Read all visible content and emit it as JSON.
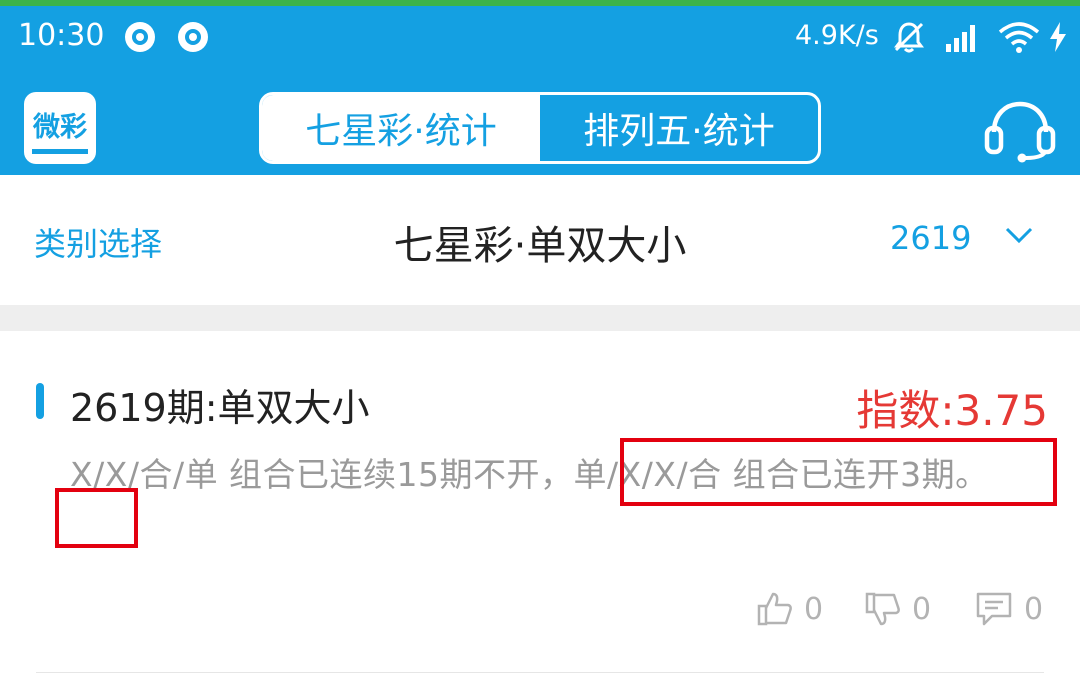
{
  "status_bar": {
    "time": "10:30",
    "net_speed": "4.9K/s",
    "icons": [
      "notification-dot-icon",
      "notification-dot-icon",
      "mute-icon",
      "signal-icon",
      "wifi-icon",
      "charging-icon"
    ]
  },
  "nav": {
    "logo_text": "微彩",
    "tabs": [
      {
        "label": "七星彩·统计",
        "active": true
      },
      {
        "label": "排列五·统计",
        "active": false
      }
    ],
    "support_icon": "headset-icon"
  },
  "title_row": {
    "category_label": "类别选择",
    "title": "七星彩·单双大小",
    "issue": "2619",
    "dropdown_icon": "chevron-down-icon"
  },
  "card": {
    "title": "2619期:单双大小",
    "index_label": "指数:3.75",
    "description": "X/X/合/单 组合已连续15期不开，单/X/X/合 组合已连开3期。",
    "likes": "0",
    "dislikes": "0",
    "comments": "0"
  },
  "colors": {
    "brand": "#14a0e2",
    "highlight": "#e53935",
    "annotation_box": "#e3000f"
  }
}
